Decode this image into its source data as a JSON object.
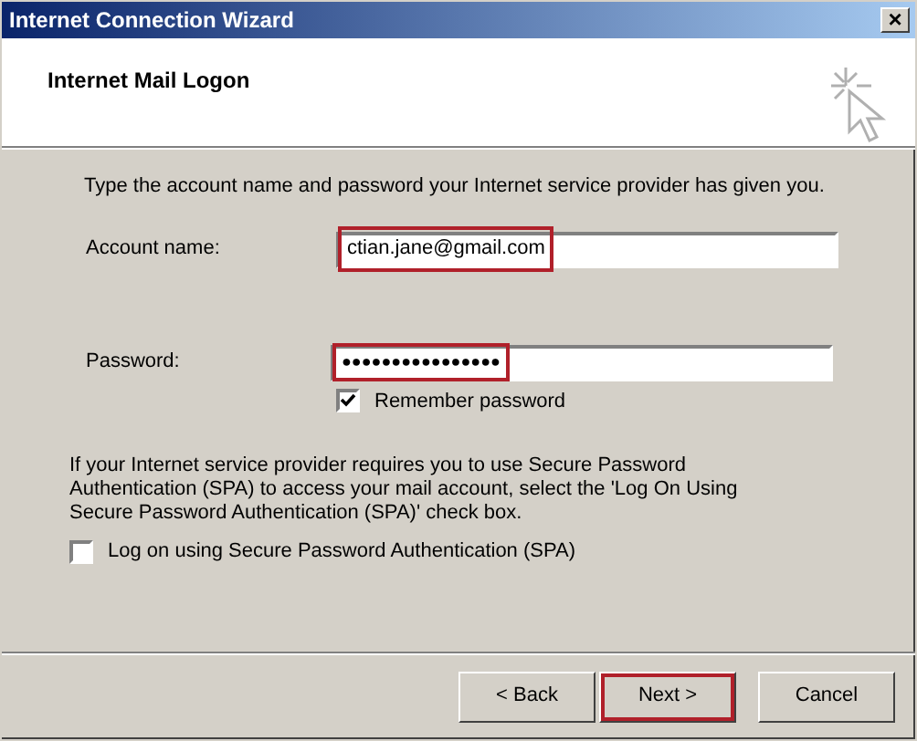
{
  "window": {
    "title": "Internet Connection Wizard",
    "close": "×"
  },
  "header": {
    "title": "Internet Mail Logon"
  },
  "instruction": "Type the account name and password your Internet service provider has given you.",
  "fields": [
    {
      "label": "Account name:",
      "value": "ctian.jane@gmail.com",
      "kind": "text",
      "highlighted": true
    },
    {
      "label": "Password:",
      "value": "●●●●●●●●●●●●●●●●",
      "kind": "password",
      "highlighted": true
    }
  ],
  "remember": {
    "label": "Remember password",
    "checked": true
  },
  "spa_note": "If your Internet service provider requires you to use Secure Password Authentication (SPA) to access your mail account, select the 'Log On Using Secure Password Authentication (SPA)' check box.",
  "spa": {
    "label": "Log on using Secure Password Authentication (SPA)",
    "checked": false
  },
  "buttons": [
    {
      "label": "< Back",
      "highlighted": false
    },
    {
      "label": "Next >",
      "highlighted": true
    },
    {
      "label": "Cancel",
      "highlighted": false
    }
  ]
}
